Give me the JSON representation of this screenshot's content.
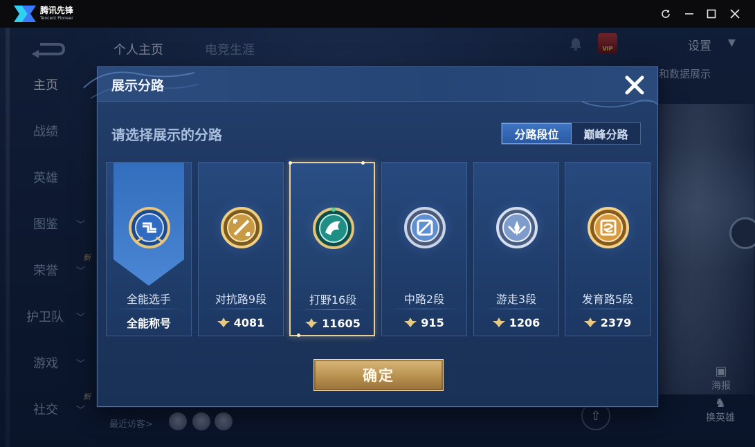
{
  "emulator": {
    "app_name": "腾讯先锋",
    "app_subtitle": "Tencent Pioneer",
    "controls": [
      "refresh-icon",
      "minimize-icon",
      "maximize-icon",
      "close-icon"
    ]
  },
  "background": {
    "top_tabs": [
      {
        "label": "个人主页"
      },
      {
        "label": "电竞生涯"
      }
    ],
    "settings_label": "设置",
    "right_text": "和数据展示",
    "sidebar": [
      {
        "label": "主页",
        "has_chevron": false,
        "new": false
      },
      {
        "label": "战绩",
        "has_chevron": false,
        "new": false
      },
      {
        "label": "英雄",
        "has_chevron": false,
        "new": false
      },
      {
        "label": "图鉴",
        "has_chevron": true,
        "new": false
      },
      {
        "label": "荣誉",
        "has_chevron": true,
        "new": true
      },
      {
        "label": "护卫队",
        "has_chevron": true,
        "new": false
      },
      {
        "label": "游戏",
        "has_chevron": true,
        "new": false
      },
      {
        "label": "社交",
        "has_chevron": true,
        "new": true
      }
    ],
    "new_tag": "新",
    "recent_visitors": "最近访客>",
    "right_buttons": [
      {
        "label": "海报"
      },
      {
        "label": "换英雄"
      }
    ]
  },
  "modal": {
    "title": "展示分路",
    "prompt": "请选择展示的分路",
    "toggle": [
      {
        "label": "分路段位",
        "active": true
      },
      {
        "label": "巅峰分路",
        "active": false
      }
    ],
    "cards": [
      {
        "id": "all",
        "label": "全能选手",
        "score": "全能称号",
        "show_icon": false,
        "selected": false,
        "badge": "all-round-badge-icon",
        "color": "#3f7fd6"
      },
      {
        "id": "clash",
        "label": "对抗路9段",
        "score": "4081",
        "show_icon": true,
        "selected": false,
        "badge": "clash-lane-badge-icon",
        "color": "#c89a3a"
      },
      {
        "id": "jungle",
        "label": "打野16段",
        "score": "11605",
        "show_icon": true,
        "selected": true,
        "badge": "jungle-badge-icon",
        "color": "#1f8f86"
      },
      {
        "id": "mid",
        "label": "中路2段",
        "score": "915",
        "show_icon": true,
        "selected": false,
        "badge": "mid-lane-badge-icon",
        "color": "#7e8da8"
      },
      {
        "id": "roam",
        "label": "游走3段",
        "score": "1206",
        "show_icon": true,
        "selected": false,
        "badge": "roam-badge-icon",
        "color": "#8aa0c0"
      },
      {
        "id": "farm",
        "label": "发育路5段",
        "score": "2379",
        "show_icon": true,
        "selected": false,
        "badge": "farm-lane-badge-icon",
        "color": "#d79a3a"
      }
    ],
    "confirm_label": "确定"
  },
  "colors": {
    "modal_bg": "#1d365f",
    "accent_blue": "#3e74c2",
    "gold": "#d9b779",
    "selected_border": "#e8cf9a"
  }
}
